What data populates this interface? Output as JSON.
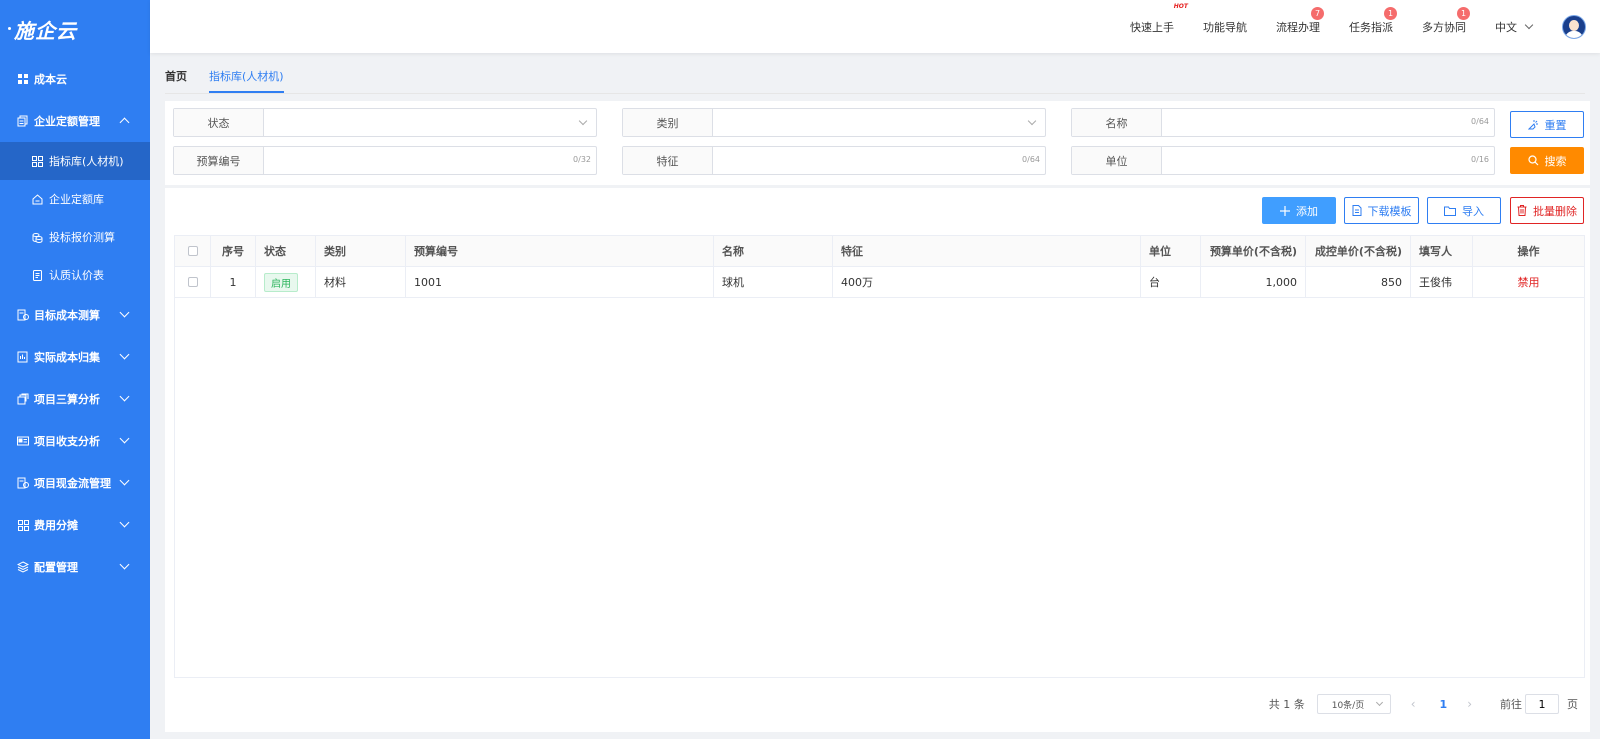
{
  "app": {
    "logo_text": "施企云"
  },
  "sidebar": {
    "items": [
      {
        "label": "成本云"
      },
      {
        "label": "企业定额管理"
      },
      {
        "label": "目标成本测算"
      },
      {
        "label": "实际成本归集"
      },
      {
        "label": "项目三算分析"
      },
      {
        "label": "项目收支分析"
      },
      {
        "label": "项目现金流管理"
      },
      {
        "label": "费用分摊"
      },
      {
        "label": "配置管理"
      }
    ],
    "sub_items": [
      {
        "label": "指标库(人材机)"
      },
      {
        "label": "企业定额库"
      },
      {
        "label": "投标报价测算"
      },
      {
        "label": "认质认价表"
      }
    ]
  },
  "topbar": {
    "quick_start": "快速上手",
    "hot": "HOT",
    "nav": "功能导航",
    "process": "流程办理",
    "process_badge": "7",
    "task": "任务指派",
    "task_badge": "1",
    "collab": "多方协同",
    "collab_badge": "1",
    "lang": "中文"
  },
  "tabs": [
    {
      "label": "首页"
    },
    {
      "label": "指标库(人材机)"
    }
  ],
  "filters": {
    "status_label": "状态",
    "category_label": "类别",
    "name_label": "名称",
    "name_count": "0/64",
    "code_label": "预算编号",
    "code_count": "0/32",
    "feature_label": "特征",
    "feature_count": "0/64",
    "unit_label": "单位",
    "unit_count": "0/16",
    "reset": "重置",
    "search": "搜索"
  },
  "actions": {
    "add": "添加",
    "download": "下载模板",
    "import": "导入",
    "batch_delete": "批量删除"
  },
  "table": {
    "headers": [
      "序号",
      "状态",
      "类别",
      "预算编号",
      "名称",
      "特征",
      "单位",
      "预算单价(不含税)",
      "成控单价(不含税)",
      "填写人",
      "操作"
    ],
    "rows": [
      {
        "no": "1",
        "status": "启用",
        "category": "材料",
        "code": "1001",
        "name": "球机",
        "feature": "400万",
        "unit": "台",
        "budget_price": "1,000",
        "control_price": "850",
        "writer": "王俊伟",
        "op": "禁用"
      }
    ]
  },
  "pager": {
    "total": "共 1 条",
    "page_size": "10条/页",
    "prev": "‹",
    "current": "1",
    "next": "›",
    "goto": "前往",
    "goto_value": "1",
    "suffix": "页"
  },
  "colors": {
    "sidebar": "#2f7ef2",
    "primary": "#2f7ef2",
    "orange": "#ff8a00",
    "danger": "#e02424"
  }
}
